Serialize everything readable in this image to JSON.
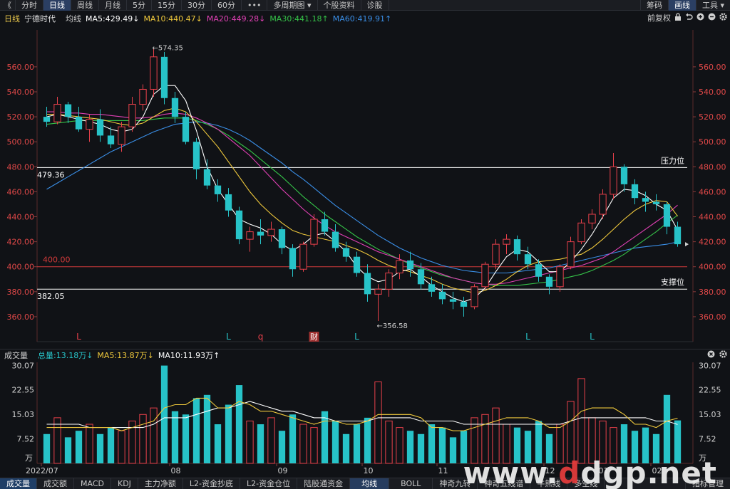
{
  "toolbar": {
    "back_glyph": "《",
    "items": [
      "分时",
      "日线",
      "周线",
      "月线",
      "5分",
      "15分",
      "30分",
      "60分",
      "•••",
      "多周期图 ▾",
      "个股资料",
      "诊股"
    ],
    "active_index": 1,
    "right": [
      "筹码",
      "画线",
      "工具 ▾"
    ]
  },
  "legend": {
    "period": "日线",
    "name": "宁德时代",
    "avg": "均线",
    "ma5": "MA5:429.49↓",
    "ma10": "MA10:440.47↓",
    "ma20": "MA20:449.28↓",
    "ma30": "MA30:441.18↑",
    "ma60": "MA60:419.91↑",
    "fuquan": "前复权"
  },
  "volume_legend": {
    "title": "成交量",
    "total": "总量:13.18万↓",
    "ma5": "MA5:13.87万↓",
    "ma10": "MA10:11.93万↑"
  },
  "chart_data": [
    {
      "type": "candlestick",
      "title": "",
      "ylim": [
        348,
        585
      ],
      "yticks": [
        360,
        380,
        400,
        420,
        440,
        460,
        480,
        500,
        520,
        540,
        560
      ],
      "ytick_labels": [
        "360.00",
        "380.00",
        "400.00",
        "420.00",
        "440.00",
        "460.00",
        "480.00",
        "500.00",
        "520.00",
        "540.00",
        "560.00"
      ],
      "grid": false,
      "colors": {
        "up": "#e8404a",
        "down": "#27c3c8",
        "ma5": "#ffffff",
        "ma10": "#f0c93c",
        "ma20": "#e040b4",
        "ma30": "#35c248",
        "ma60": "#3a8ee6"
      },
      "candles": [
        [
          520,
          528,
          512,
          516
        ],
        [
          516,
          536,
          514,
          530
        ],
        [
          530,
          532,
          515,
          520
        ],
        [
          520,
          528,
          508,
          510
        ],
        [
          510,
          522,
          500,
          518
        ],
        [
          518,
          526,
          500,
          505
        ],
        [
          505,
          512,
          495,
          498
        ],
        [
          498,
          516,
          492,
          512
        ],
        [
          512,
          536,
          508,
          530
        ],
        [
          530,
          546,
          525,
          542
        ],
        [
          542,
          574.35,
          536,
          568
        ],
        [
          568,
          572,
          530,
          535
        ],
        [
          535,
          540,
          515,
          520
        ],
        [
          520,
          524,
          498,
          500
        ],
        [
          500,
          503,
          470,
          478
        ],
        [
          478,
          486,
          462,
          465
        ],
        [
          465,
          470,
          452,
          458
        ],
        [
          458,
          463,
          440,
          445
        ],
        [
          445,
          448,
          418,
          422
        ],
        [
          422,
          432,
          412,
          428
        ],
        [
          428,
          438,
          418,
          425
        ],
        [
          425,
          436,
          420,
          430
        ],
        [
          430,
          432,
          410,
          415
        ],
        [
          415,
          418,
          392,
          398
        ],
        [
          398,
          420,
          396,
          418
        ],
        [
          418,
          442,
          416,
          438
        ],
        [
          438,
          444,
          425,
          428
        ],
        [
          428,
          434,
          412,
          415
        ],
        [
          415,
          420,
          404,
          408
        ],
        [
          408,
          412,
          392,
          395
        ],
        [
          395,
          402,
          372,
          378
        ],
        [
          378,
          386,
          356.58,
          382
        ],
        [
          382,
          398,
          376,
          395
        ],
        [
          395,
          410,
          390,
          405
        ],
        [
          405,
          412,
          392,
          398
        ],
        [
          398,
          403,
          382,
          386
        ],
        [
          386,
          392,
          376,
          380
        ],
        [
          380,
          386,
          370,
          374
        ],
        [
          374,
          380,
          366,
          372
        ],
        [
          372,
          376,
          360,
          368
        ],
        [
          368,
          386,
          366,
          384
        ],
        [
          384,
          404,
          382,
          402
        ],
        [
          402,
          422,
          398,
          418
        ],
        [
          418,
          426,
          410,
          422
        ],
        [
          422,
          425,
          405,
          410
        ],
        [
          410,
          416,
          398,
          402
        ],
        [
          402,
          406,
          388,
          392
        ],
        [
          392,
          394,
          378,
          384
        ],
        [
          384,
          402,
          380,
          400
        ],
        [
          400,
          424,
          398,
          420
        ],
        [
          420,
          438,
          418,
          435
        ],
        [
          435,
          446,
          430,
          442
        ],
        [
          442,
          462,
          438,
          458
        ],
        [
          458,
          491,
          454,
          480
        ],
        [
          480,
          482,
          460,
          466
        ],
        [
          466,
          470,
          450,
          455
        ],
        [
          455,
          460,
          444,
          452
        ],
        [
          452,
          458,
          445,
          450
        ],
        [
          450,
          452,
          426,
          432
        ],
        [
          432,
          436,
          416,
          418
        ]
      ],
      "ma5": [
        520,
        522,
        520,
        518,
        516,
        514,
        510,
        508,
        510,
        520,
        538,
        545,
        545,
        533,
        509,
        480,
        462,
        450,
        438,
        434,
        431,
        426,
        418,
        413,
        418,
        425,
        427,
        420,
        412,
        400,
        392,
        388,
        390,
        396,
        398,
        392,
        385,
        380,
        375,
        372,
        375,
        383,
        396,
        408,
        414,
        412,
        404,
        396,
        396,
        404,
        414,
        426,
        440,
        455,
        462,
        461,
        457,
        450,
        445,
        429.49
      ],
      "ma10": [
        522,
        522,
        521,
        520,
        519,
        518,
        516,
        514,
        513,
        515,
        520,
        525,
        527,
        524,
        516,
        506,
        496,
        484,
        472,
        460,
        450,
        442,
        435,
        429,
        426,
        424,
        422,
        420,
        417,
        414,
        410,
        405,
        401,
        398,
        396,
        393,
        390,
        386,
        383,
        381,
        379,
        381,
        385,
        390,
        396,
        401,
        404,
        405,
        406,
        408,
        410,
        415,
        422,
        430,
        438,
        445,
        450,
        453,
        452,
        440.47
      ],
      "ma20": [
        524,
        524,
        523,
        523,
        522,
        522,
        521,
        520,
        519,
        519,
        520,
        522,
        523,
        522,
        519,
        515,
        510,
        503,
        496,
        489,
        480,
        471,
        462,
        454,
        446,
        439,
        433,
        428,
        424,
        420,
        416,
        412,
        409,
        406,
        403,
        400,
        397,
        394,
        391,
        389,
        387,
        386,
        386,
        387,
        389,
        391,
        393,
        395,
        397,
        399,
        401,
        404,
        407,
        412,
        418,
        424,
        430,
        436,
        442,
        449.28
      ],
      "ma30": [
        514,
        515,
        516,
        517,
        517,
        517,
        517,
        517,
        517,
        517,
        518,
        519,
        519,
        519,
        517,
        514,
        510,
        505,
        499,
        493,
        486,
        479,
        472,
        464,
        456,
        449,
        442,
        436,
        430,
        424,
        419,
        414,
        410,
        406,
        402,
        399,
        396,
        393,
        391,
        389,
        387,
        386,
        385,
        385,
        385,
        386,
        387,
        388,
        390,
        392,
        394,
        397,
        401,
        405,
        410,
        416,
        422,
        428,
        435,
        441.18
      ],
      "ma60": [
        462,
        467,
        472,
        477,
        482,
        487,
        492,
        496,
        500,
        504,
        508,
        511,
        514,
        515,
        516,
        515,
        513,
        510,
        506,
        501,
        495,
        489,
        483,
        476,
        470,
        463,
        456,
        449,
        443,
        437,
        431,
        425,
        420,
        415,
        411,
        407,
        404,
        401,
        399,
        397,
        396,
        395,
        395,
        395,
        396,
        397,
        398,
        399,
        401,
        403,
        405,
        407,
        409,
        411,
        413,
        415,
        416,
        417,
        418,
        419.91
      ],
      "annotations": [
        {
          "text": "←574.35",
          "x": 10,
          "y": 574.35
        },
        {
          "text": "←356.58",
          "x": 31,
          "y": 356.58
        }
      ],
      "levels": [
        {
          "text": "479.36",
          "y": 479.36,
          "label": "压力位",
          "color": "#ffffff"
        },
        {
          "text": "382.05",
          "y": 382.05,
          "label": "支撑位",
          "color": "#ffffff"
        },
        {
          "text": "400.00",
          "y": 400,
          "label": "",
          "color": "#d03a3a"
        }
      ],
      "markers": [
        {
          "text": "L",
          "x": 3,
          "color": "#e8404a"
        },
        {
          "text": "L",
          "x": 17,
          "color": "#27c3c8"
        },
        {
          "text": "q",
          "x": 20,
          "color": "#e8404a"
        },
        {
          "text": "财",
          "x": 25,
          "color": "#ffffff"
        },
        {
          "text": "L",
          "x": 29,
          "color": "#27c3c8"
        },
        {
          "text": "L",
          "x": 45,
          "color": "#27c3c8"
        },
        {
          "text": "L",
          "x": 51,
          "color": "#27c3c8"
        }
      ]
    },
    {
      "type": "bar",
      "title": "成交量",
      "ylim": [
        0,
        31
      ],
      "yticks": [
        7.52,
        15.03,
        22.55,
        30.07
      ],
      "ytick_labels": [
        "7.52",
        "15.03",
        "22.55",
        "30.07"
      ],
      "unit": "万",
      "xlabels": [
        "2022/07",
        "08",
        "09",
        "10",
        "11",
        "12",
        "01",
        "02"
      ],
      "xlabel_positions": [
        0,
        12,
        22,
        30,
        37,
        47,
        52,
        57
      ],
      "values": [
        9,
        14,
        8,
        10,
        12,
        9,
        11,
        10,
        13,
        15,
        17,
        30,
        16,
        15,
        20,
        21,
        12,
        18,
        24,
        13,
        12,
        14,
        10,
        15,
        12,
        11,
        16,
        13,
        9,
        12,
        14,
        25,
        13,
        11,
        10,
        9,
        12,
        11,
        8,
        10,
        14,
        15,
        17,
        12,
        11,
        10,
        13,
        9,
        12,
        19,
        26,
        14,
        13,
        11,
        12,
        10,
        11,
        9,
        21,
        13.18
      ],
      "ma5": [
        11,
        11,
        11,
        11,
        11,
        11,
        11,
        10,
        11,
        12,
        13,
        17,
        18,
        18,
        20,
        20,
        17,
        17,
        19,
        18,
        16,
        16,
        15,
        14,
        13,
        12,
        13,
        13,
        12,
        12,
        13,
        15,
        15,
        15,
        15,
        14,
        11,
        11,
        10,
        10,
        11,
        12,
        13,
        14,
        14,
        14,
        13,
        11,
        11,
        13,
        16,
        17,
        17,
        17,
        15,
        12,
        12,
        11,
        13,
        13.87
      ],
      "ma10": [
        12,
        12,
        12,
        12,
        11,
        11,
        11,
        11,
        11,
        11,
        12,
        14,
        14,
        14,
        15,
        16,
        17,
        17,
        18,
        19,
        18,
        17,
        16,
        16,
        15,
        14,
        14,
        13,
        13,
        13,
        13,
        14,
        14,
        14,
        14,
        13,
        13,
        13,
        13,
        12,
        12,
        12,
        12,
        12,
        12,
        12,
        12,
        12,
        12,
        13,
        14,
        14,
        14,
        14,
        14,
        14,
        14,
        13,
        13,
        11.93
      ]
    }
  ],
  "volume_unit": "万",
  "right_icons": [
    "lock-icon",
    "undo-icon",
    "zoom-in-icon",
    "zoom-out-icon",
    "gear-icon"
  ],
  "bottom_tabs": [
    "成交量",
    "成交额",
    "MACD",
    "KDJ",
    "主力净额",
    "L2-资金抄底",
    "L2-资金仓位",
    "陆股通资金",
    "均线",
    "BOLL",
    "神奇九转",
    "神奇五线谱",
    "牛熊线",
    "多空线",
    "指标管理"
  ],
  "bottom_active": [
    0,
    8
  ],
  "watermark": "www.ddgp.net"
}
